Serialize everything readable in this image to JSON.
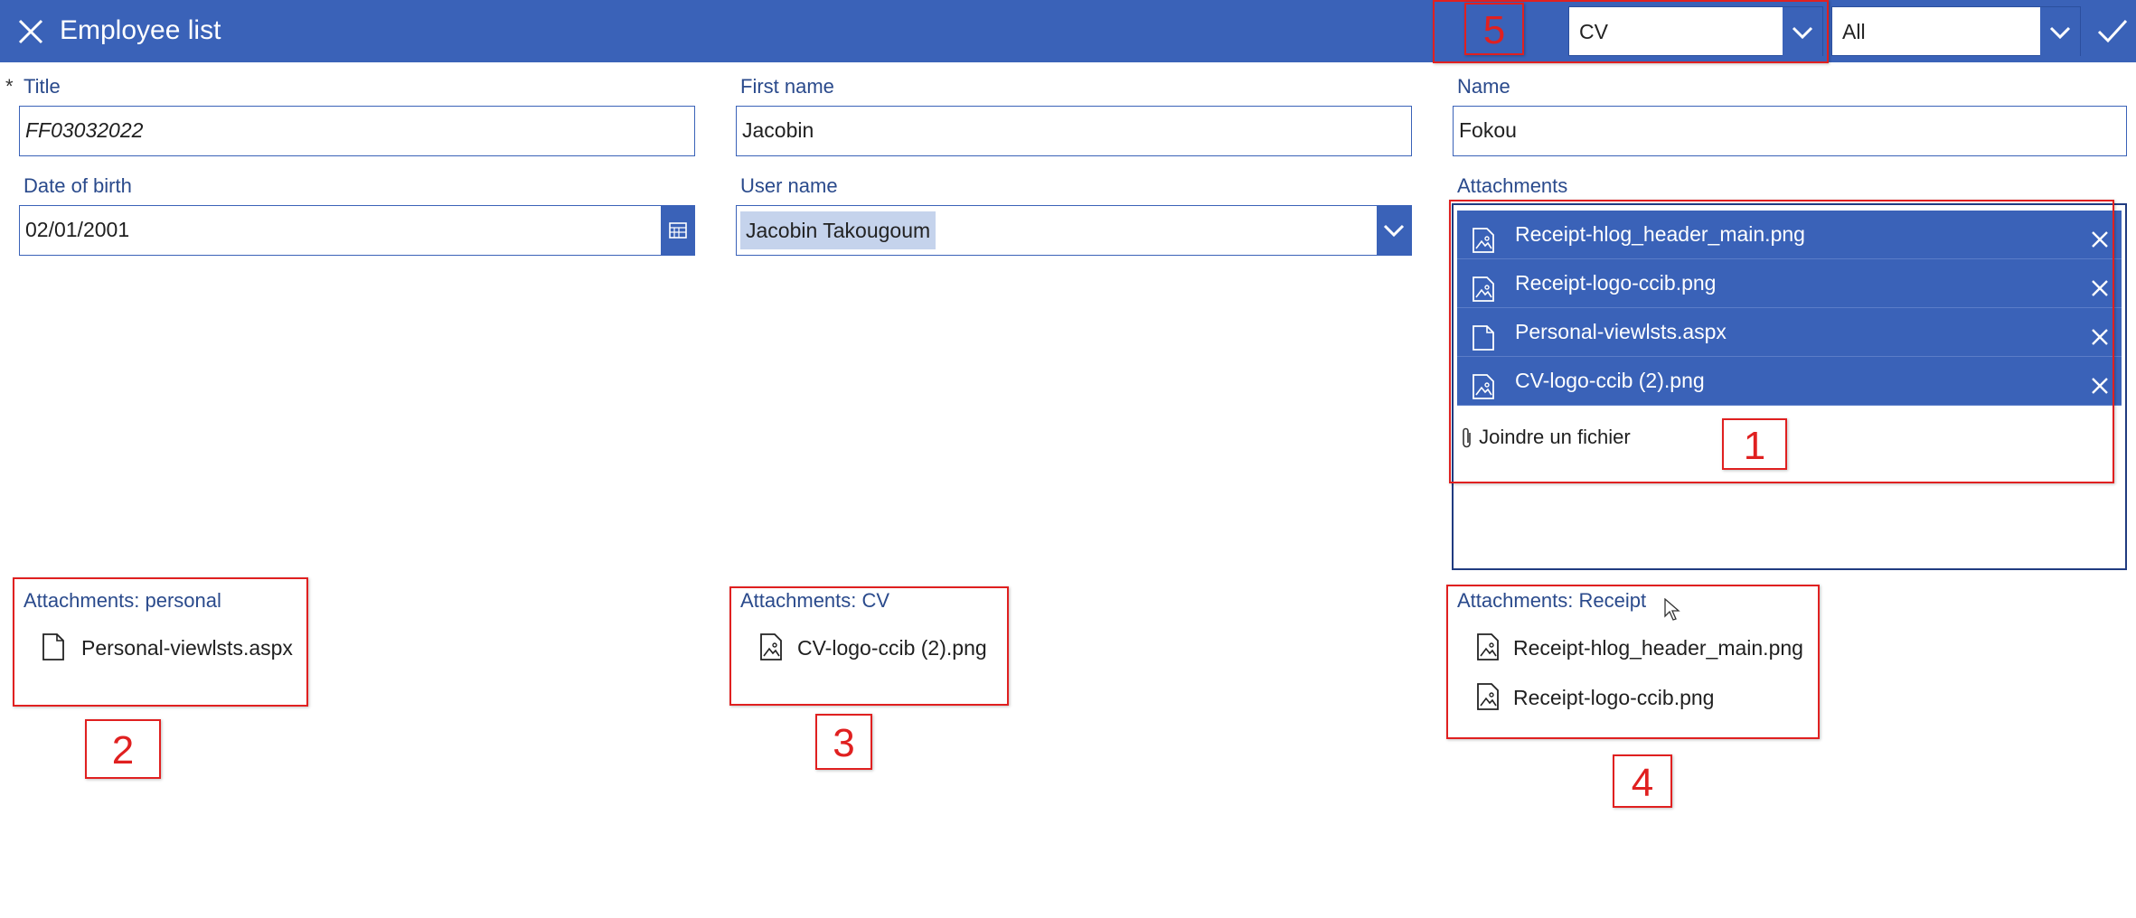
{
  "header": {
    "title": "Employee list"
  },
  "filters": {
    "type_value": "CV",
    "scope_value": "All"
  },
  "form": {
    "title": {
      "label": "Title",
      "required_mark": "*",
      "value": "FF03032022"
    },
    "first_name": {
      "label": "First name",
      "value": "Jacobin"
    },
    "name": {
      "label": "Name",
      "value": "Fokou"
    },
    "date_of_birth": {
      "label": "Date of birth",
      "value": "02/01/2001"
    },
    "user_name": {
      "label": "User name",
      "value": "Jacobin Takougoum"
    },
    "attachments": {
      "label": "Attachments",
      "items": [
        {
          "name": "Receipt-hlog_header_main.png",
          "icon": "image-file-icon"
        },
        {
          "name": "Receipt-logo-ccib.png",
          "icon": "image-file-icon"
        },
        {
          "name": "Personal-viewlsts.aspx",
          "icon": "document-icon"
        },
        {
          "name": "CV-logo-ccib (2).png",
          "icon": "image-file-icon"
        }
      ],
      "add_label": "Joindre un fichier"
    }
  },
  "galleries": {
    "personal": {
      "label": "Attachments: personal",
      "items": [
        "Personal-viewlsts.aspx"
      ]
    },
    "cv": {
      "label": "Attachments: CV",
      "items": [
        "CV-logo-ccib (2).png"
      ]
    },
    "receipt": {
      "label": "Attachments: Receipt",
      "items": [
        "Receipt-hlog_header_main.png",
        "Receipt-logo-ccib.png"
      ]
    }
  },
  "callouts": {
    "c1": "1",
    "c2": "2",
    "c3": "3",
    "c4": "4",
    "c5": "5"
  },
  "colors": {
    "header": "#3a62b8",
    "label": "#2a4a8c",
    "annotation": "#e02020"
  }
}
